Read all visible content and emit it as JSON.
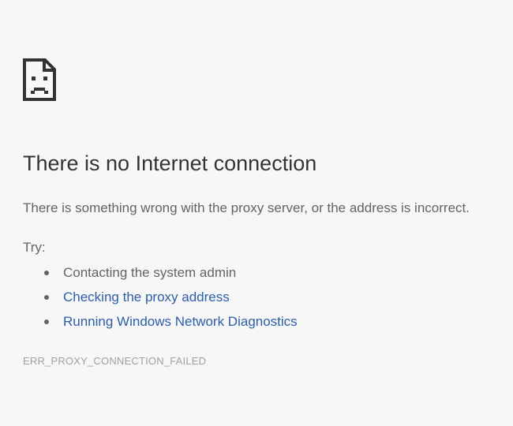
{
  "icon": "sad-page-icon",
  "headline": "There is no Internet connection",
  "description": "There is something wrong with the proxy server, or the address is incorrect.",
  "try_label": "Try:",
  "suggestions": [
    {
      "text": "Contacting the system admin",
      "is_link": false
    },
    {
      "text": "Checking the proxy address",
      "is_link": true
    },
    {
      "text": "Running Windows Network Diagnostics",
      "is_link": true
    }
  ],
  "error_code": "ERR_PROXY_CONNECTION_FAILED",
  "colors": {
    "background": "#f7f7f7",
    "headline": "#333333",
    "body_text": "#646464",
    "link": "#2d5ea8",
    "error_code": "#a0a0a0"
  }
}
